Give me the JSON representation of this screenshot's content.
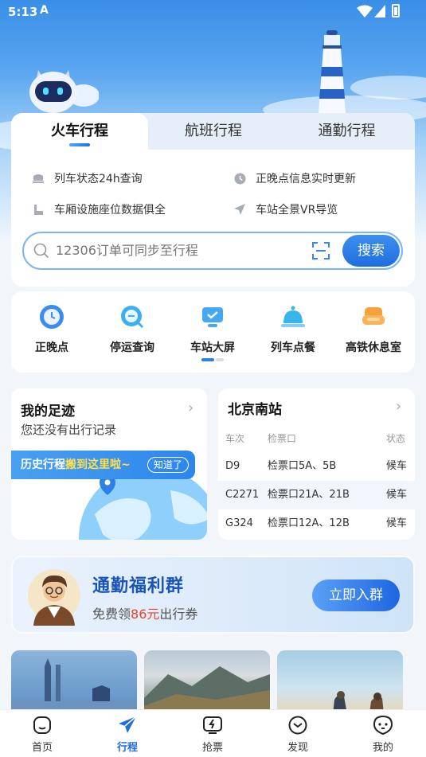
{
  "status_bar": {
    "time": "5:13",
    "app_glyph": "A"
  },
  "tabs": [
    {
      "label": "火车行程",
      "active": true
    },
    {
      "label": "航班行程",
      "active": false
    },
    {
      "label": "通勤行程",
      "active": false
    }
  ],
  "features": [
    {
      "icon": "train-icon",
      "label": "列车状态24h查询"
    },
    {
      "icon": "clock-icon",
      "label": "正晚点信息实时更新"
    },
    {
      "icon": "seat-icon",
      "label": "车厢设施座位数据俱全"
    },
    {
      "icon": "navigation-icon",
      "label": "车站全景VR导览"
    }
  ],
  "search": {
    "placeholder": "12306订单可同步至行程",
    "button": "搜索"
  },
  "quick_actions": [
    {
      "icon": "clock-icon",
      "label": "正晚点",
      "color": "#3b8cf0"
    },
    {
      "icon": "search-icon",
      "label": "停运查询",
      "color": "#3ab0f0"
    },
    {
      "icon": "screen-icon",
      "label": "车站大屏",
      "color": "#46a8f5"
    },
    {
      "icon": "bell-icon",
      "label": "列车点餐",
      "color": "#38b6e8"
    },
    {
      "icon": "sofa-icon",
      "label": "高铁休息室",
      "color": "#f5a23a"
    }
  ],
  "footprint": {
    "title": "我的足迹",
    "subtitle": "您还没有出行记录",
    "banner_pre": "历史行程",
    "banner_highlight": "搬到这里啦~",
    "banner_button": "知道了"
  },
  "station": {
    "title": "北京南站",
    "headers": [
      "车次",
      "检票口",
      "状态"
    ],
    "rows": [
      {
        "train": "D9",
        "gate": "检票口5A、5B",
        "status": "候车"
      },
      {
        "train": "C2271",
        "gate": "检票口21A、21B",
        "status": "候车"
      },
      {
        "train": "G324",
        "gate": "检票口12A、12B",
        "status": "候车"
      }
    ]
  },
  "commute": {
    "title": "通勤福利群",
    "sub_pre": "免费领",
    "amount": "86元",
    "sub_post": "出行券",
    "button": "立即入群"
  },
  "nav": [
    {
      "icon": "home-icon",
      "label": "首页",
      "active": false
    },
    {
      "icon": "trip-icon",
      "label": "行程",
      "active": true
    },
    {
      "icon": "ticket-grab-icon",
      "label": "抢票",
      "active": false
    },
    {
      "icon": "discover-icon",
      "label": "发现",
      "active": false
    },
    {
      "icon": "profile-icon",
      "label": "我的",
      "active": false
    }
  ],
  "colors": {
    "accent": "#1f6ee0",
    "highlight": "#e8452c",
    "banner_text": "#ffe14d"
  }
}
